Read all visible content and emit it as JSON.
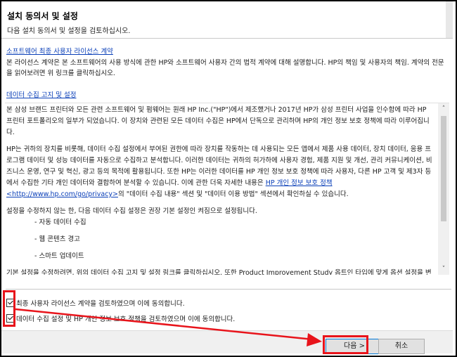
{
  "header": {
    "title": "설치 동의서 및 설정",
    "subtitle": "다음 설치 동의서 및 설정을 검토하십시오."
  },
  "eula": {
    "link": "소프트웨어 최종 사용자 라이선스 계약",
    "text": "본 라이선스 계약은 본 소프트웨어의 사용 방식에 관한 HP와 소프트웨어 사용자 간의 법적 계약에 대해 설명합니다. HP의 책임 및 사용자의 책임. 계약의 전문을 읽어보려면 위 링크를 클릭하십시오."
  },
  "data_collection": {
    "link": "데이터 수집 고지 및 설정",
    "p1": "본 삼성 브랜드 프린터와 모든 관련 소프트웨어 및 펌웨어는 원래 HP Inc.(\"HP\")에서 제조했거나 2017년 HP가 삼성 프린터 사업을 인수함에 따라 HP 프린터 포트폴리오의 일부가 되었습니다. 이 장치와 관련된 모든 데이터 수집은 HP에서 단독으로 관리하며 HP의 개인 정보 보호 정책에 따라 이루어집니다.",
    "p2_a": "HP는 귀하의 장치를 비롯해, 데이터 수집 설정에서 부여된 권한에 따라 장치를 작동하는 데 사용되는 모든 앱에서 제품 사용 데이터, 장치 데이터, 응용 프로그램 데이터 및 성능 데이터를 자동으로 수집하고 분석합니다. 이러한 데이터는 귀하의 허가하에 사용자 경험, 제품 지원 및 개선, 관리 커뮤니케이션, 비즈니스 운영, 연구 및 혁신, 광고 등의 목적에 활용됩니다. 또한 HP는 이러한 데이터를 HP 개인 정보 보호 정책에 따라 사용자, 다른 HP 고객 및 제3자 등에서 수집한 기타 개인 데이터와 결합하여 분석할 수 있습니다. 이에 관한 더욱 자세한 내용은 ",
    "p2_link": "HP 개인 정보 보호 정책 <http://www.hp.com/go/privacy>",
    "p2_b": "의 \"데이터 수집 내용\" 섹션 및 \"데이터 이용 방법\" 섹션에서 확인하실 수 있습니다.",
    "p3": "설정을 수정하지 않는 한, 다음 데이터 수집 설정은 권장 기본 설정인 켜짐으로 설정됩니다.",
    "list": [
      "- 자동 데이터 수집",
      "- 웹 콘텐츠 경고",
      "- 스마트 업데이트"
    ],
    "p4": "기본 설정을 수정하려면, 위의 데이터 수집 고지 및 설정 링크를 클릭하십시오. 또한 Product Improvement Study 옵트인 타입에 맞게 옵션 설정을 변경할 수 있습니다."
  },
  "checkboxes": [
    {
      "label": "최종 사용자 라이선스 계약을 검토하였으며 이에 동의합니다.",
      "checked": true
    },
    {
      "label": "데이터 수집 설정 및 HP 개인 정보 보호 정책을 검토하였으며 이에 동의합니다.",
      "checked": true
    }
  ],
  "buttons": {
    "next": "다음 >",
    "cancel": "취소"
  },
  "colors": {
    "highlight": "#e8141b",
    "link": "#0a3fb8"
  }
}
